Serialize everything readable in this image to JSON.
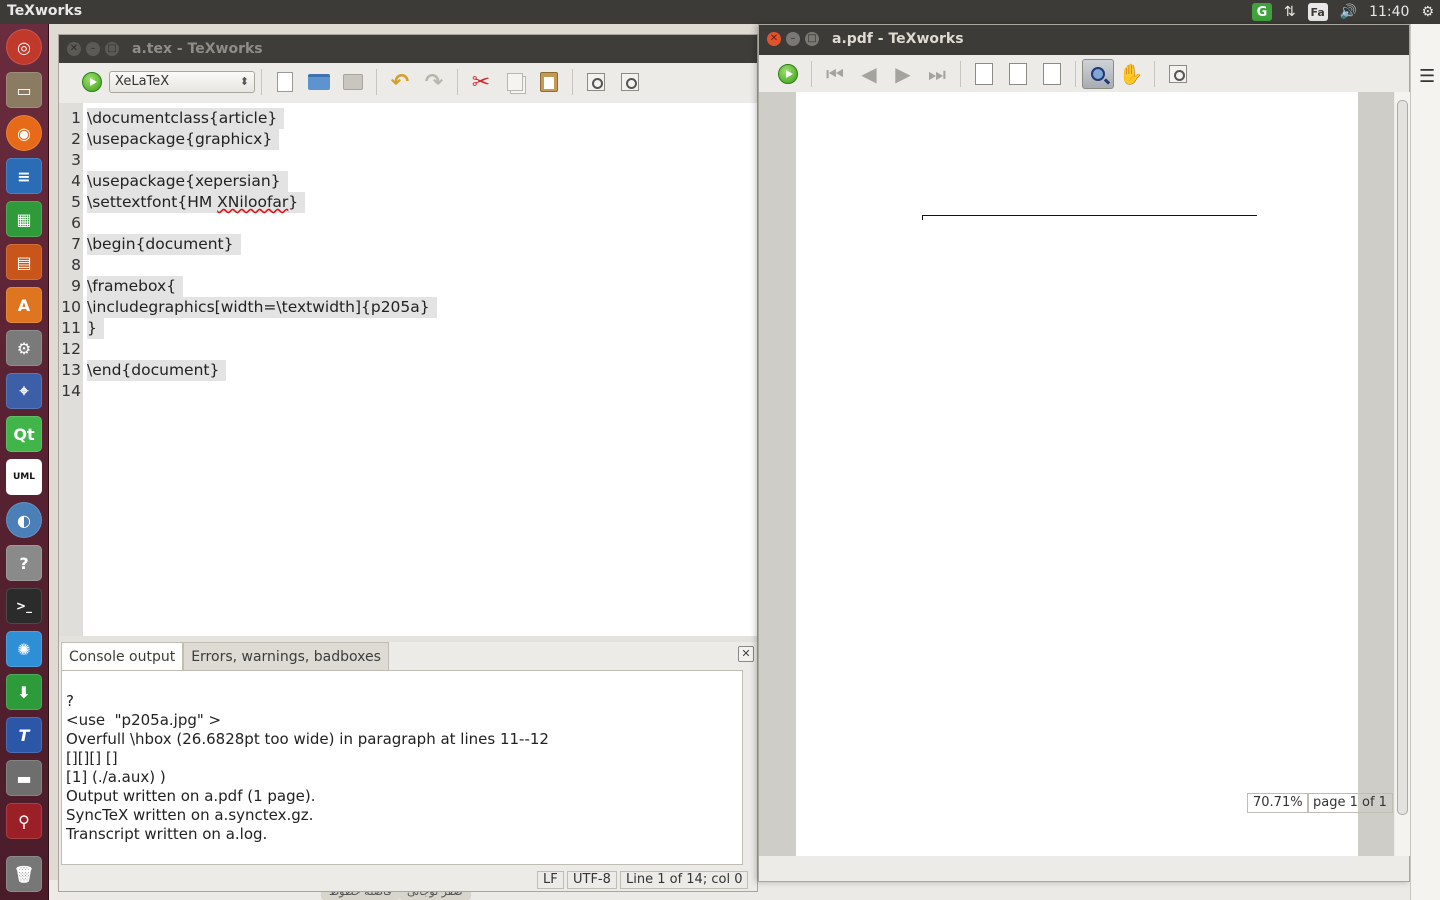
{
  "top_panel": {
    "app_title": "TeXworks",
    "tray": {
      "grammarly": "G",
      "network": "⇅",
      "keyboard_layout": "Fa",
      "volume": "🔊",
      "clock": "11:40",
      "settings": "⚙"
    }
  },
  "launcher": {
    "items": [
      "Ubuntu Dash",
      "Files",
      "Firefox",
      "LibreOffice Writer",
      "LibreOffice Calc",
      "LibreOffice Impress",
      "Ubuntu Software",
      "System Settings",
      "Screenshot",
      "Qt Creator",
      "UML Designer",
      "Remmina",
      "Help",
      "Terminal",
      "Xscreensaver",
      "Transmission",
      "TeXworks",
      "Drive",
      "USB Drive",
      "Trash"
    ],
    "qt_label": "Qt",
    "uml_label": "UML",
    "help_label": "?",
    "terminal_label": ">_",
    "texworks_label": "T"
  },
  "editor": {
    "window_title": "a.tex - TeXworks",
    "engine": "XeLaTeX",
    "code_lines": [
      {
        "num": "1",
        "text": "\\documentclass{article}"
      },
      {
        "num": "2",
        "text": "\\usepackage{graphicx}"
      },
      {
        "num": "3",
        "text": ""
      },
      {
        "num": "4",
        "text": "\\usepackage{xepersian}"
      },
      {
        "num": "5",
        "text_before": "\\settextfont{HM ",
        "text_misspelled": "XNiloofar",
        "text_after": "}"
      },
      {
        "num": "6",
        "text": ""
      },
      {
        "num": "7",
        "text": "\\begin{document}"
      },
      {
        "num": "8",
        "text": ""
      },
      {
        "num": "9",
        "text": "\\framebox{"
      },
      {
        "num": "10",
        "text": "\\includegraphics[width=\\textwidth]{p205a}"
      },
      {
        "num": "11",
        "text": "}"
      },
      {
        "num": "12",
        "text": ""
      },
      {
        "num": "13",
        "text": "\\end{document}"
      },
      {
        "num": "14",
        "text": ""
      }
    ],
    "tabs": {
      "console": "Console output",
      "errors": "Errors, warnings, badboxes"
    },
    "console_lines": [
      "?",
      "<use  \"p205a.jpg\" >",
      "Overfull \\hbox (26.6828pt too wide) in paragraph at lines 11--12",
      "[][][] []",
      "[1] (./a.aux) )",
      "Output written on a.pdf (1 page).",
      "SyncTeX written on a.synctex.gz.",
      "Transcript written on a.log."
    ],
    "status": {
      "line_ending": "LF",
      "encoding": "UTF-8",
      "position": "Line 1 of 14; col 0"
    }
  },
  "pdf": {
    "window_title": "a.pdf - TeXworks",
    "zoom": "70.71%",
    "page": "page 1 of 1"
  },
  "desktop": {
    "bottom_labels": [
      "فاصله خطوط",
      "صفر نوجانی"
    ]
  },
  "colors": {
    "title_bar": "#3c3b37",
    "launcher": "#5a2333",
    "run_green": "#3a9c1c",
    "close_red": "#e0532c"
  }
}
